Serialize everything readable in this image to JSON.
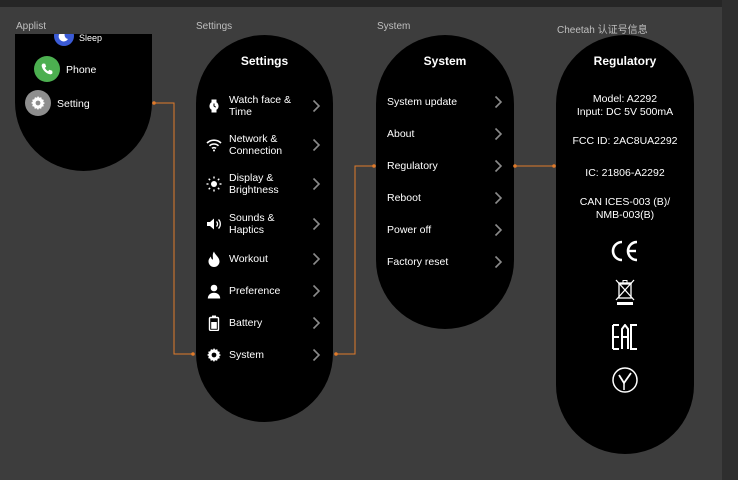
{
  "frame_labels": {
    "applist": "Applist",
    "settings": "Settings",
    "system": "System",
    "regulatory": "Cheetah 认证号信息"
  },
  "applist": {
    "items": [
      {
        "label": "Sleep",
        "icon": "moon-icon",
        "color": "#3b5bd6"
      },
      {
        "label": "Phone",
        "icon": "phone-icon",
        "color": "#4caf50"
      },
      {
        "label": "Setting",
        "icon": "gear-icon",
        "color": "#8e8e8e"
      }
    ]
  },
  "settings_screen": {
    "title": "Settings",
    "items": [
      {
        "label": "Watch face & Time",
        "icon": "watch-icon"
      },
      {
        "label": "Network & Connection",
        "icon": "wifi-icon"
      },
      {
        "label": "Display & Brightness",
        "icon": "sun-icon"
      },
      {
        "label": "Sounds & Haptics",
        "icon": "speaker-icon"
      },
      {
        "label": "Workout",
        "icon": "flame-icon"
      },
      {
        "label": "Preference",
        "icon": "person-icon"
      },
      {
        "label": "Battery",
        "icon": "battery-icon"
      },
      {
        "label": "System",
        "icon": "gear-icon"
      }
    ]
  },
  "system_screen": {
    "title": "System",
    "items": [
      {
        "label": "System update"
      },
      {
        "label": "About"
      },
      {
        "label": "Regulatory"
      },
      {
        "label": "Reboot"
      },
      {
        "label": "Power off"
      },
      {
        "label": "Factory reset"
      }
    ]
  },
  "regulatory_screen": {
    "title": "Regulatory",
    "model": "Model: A2292",
    "input": "Input: DC 5V 500mA",
    "fcc": "FCC ID: 2AC8UA2292",
    "ic": "IC: 21806-A2292",
    "can_line1": "CAN ICES-003 (B)/",
    "can_line2": "NMB-003(B)",
    "marks": [
      "ce-mark-icon",
      "weee-bin-icon",
      "eac-mark-icon",
      "ukca-check-icon"
    ]
  },
  "colors": {
    "canvas": "#3d3d3d",
    "screen": "#000000",
    "connector": "#e07a2a",
    "chevron": "#8a8a8a"
  }
}
